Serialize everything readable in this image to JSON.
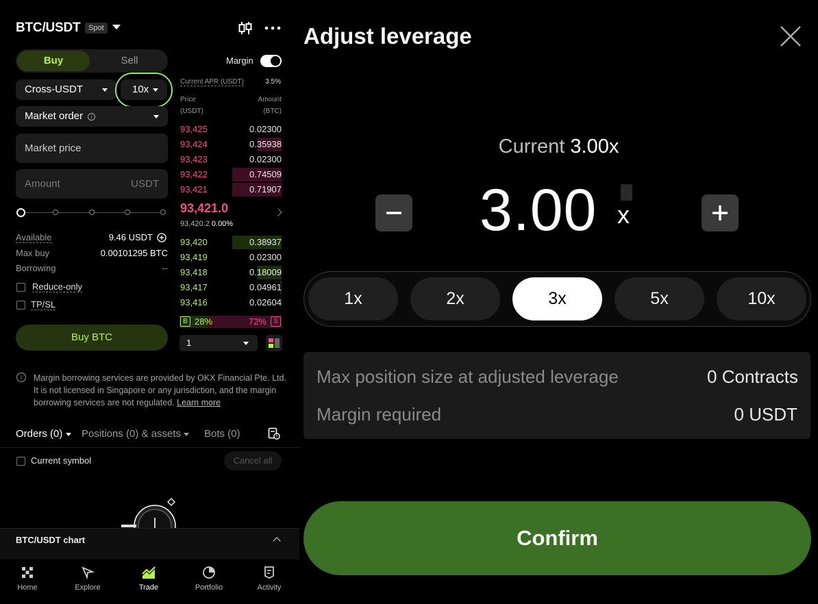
{
  "header": {
    "pair": "BTC/USDT",
    "market_type": "Spot"
  },
  "trade_form": {
    "buy_tab": "Buy",
    "sell_tab": "Sell",
    "margin_label": "Margin",
    "margin_mode": "Cross-USDT",
    "leverage": "10x",
    "order_type": "Market order",
    "order_type_info": "i",
    "price_field": "Market price",
    "amount_placeholder": "Amount",
    "amount_unit": "USDT",
    "slider_fraction": 0,
    "available_label": "Available",
    "available_value": "9.46 USDT",
    "max_buy_label": "Max buy",
    "max_buy_value": "0.00101295 BTC",
    "borrowing_label": "Borrowing",
    "borrowing_value": "--",
    "reduce_only_label": "Reduce-only",
    "tpsl_label": "TP/SL",
    "buy_button": "Buy BTC"
  },
  "order_book": {
    "apr_label": "Current APR (USDT)",
    "apr_value": "3.5%",
    "price_header": "Price",
    "price_unit": "(USDT)",
    "amount_header": "Amount",
    "amount_unit": "(BTC)",
    "asks": [
      {
        "price": "93,425",
        "amount": "0.02300",
        "depth": 0.0
      },
      {
        "price": "93,424",
        "amount": "0.35938",
        "depth": 0.48
      },
      {
        "price": "93,423",
        "amount": "0.02300",
        "depth": 0.0
      },
      {
        "price": "93,422",
        "amount": "0.74509",
        "depth": 1.0
      },
      {
        "price": "93,421",
        "amount": "0.71907",
        "depth": 1.0
      }
    ],
    "mid_price": "93,421.0",
    "mid_sub_price": "93,420.2",
    "mid_change": "0.00%",
    "bids": [
      {
        "price": "93,420",
        "amount": "0.38937",
        "depth": 1.0
      },
      {
        "price": "93,419",
        "amount": "0.02300",
        "depth": 0.0
      },
      {
        "price": "93,418",
        "amount": "0.18009",
        "depth": 0.5
      },
      {
        "price": "93,417",
        "amount": "0.04961",
        "depth": 0.03
      },
      {
        "price": "93,416",
        "amount": "0.02604",
        "depth": 0.02
      }
    ],
    "buy_badge": "B",
    "buy_ratio": "28%",
    "sell_ratio": "72%",
    "sell_badge": "S",
    "buy_ratio_value": 0.28,
    "depth_value": "1"
  },
  "disclaimer": {
    "text": "Margin borrowing services are provided by OKX Financial Pte. Ltd. It is not licensed in Singapore or any jurisdiction, and the margin borrowing services are not regulated.",
    "link": "Learn more"
  },
  "orders_tabs": {
    "orders": "Orders (0)",
    "positions": "Positions (0) & assets",
    "bots": "Bots (0)",
    "current_symbol": "Current symbol",
    "cancel_all": "Cancel all"
  },
  "chart_bar": {
    "label": "BTC/USDT chart"
  },
  "bottom_nav": [
    "Home",
    "Explore",
    "Trade",
    "Portfolio",
    "Activity"
  ],
  "leverage_modal": {
    "title": "Adjust leverage",
    "current_label": "Current",
    "current_value": "3.00x",
    "value": "3.00",
    "unit": "x",
    "minus": "−",
    "plus": "+",
    "presets": [
      "1x",
      "2x",
      "3x",
      "5x",
      "10x"
    ],
    "selected_preset": "3x",
    "max_position_label": "Max position size at adjusted leverage",
    "max_position_value": "0 Contracts",
    "margin_required_label": "Margin required",
    "margin_required_value": "0 USDT",
    "confirm": "Confirm"
  },
  "colors": {
    "buy_green": "#b6f04c",
    "sell_pink": "#f0508a",
    "confirm_green": "#3c7025",
    "highlight_ring": "#8fe46a"
  }
}
